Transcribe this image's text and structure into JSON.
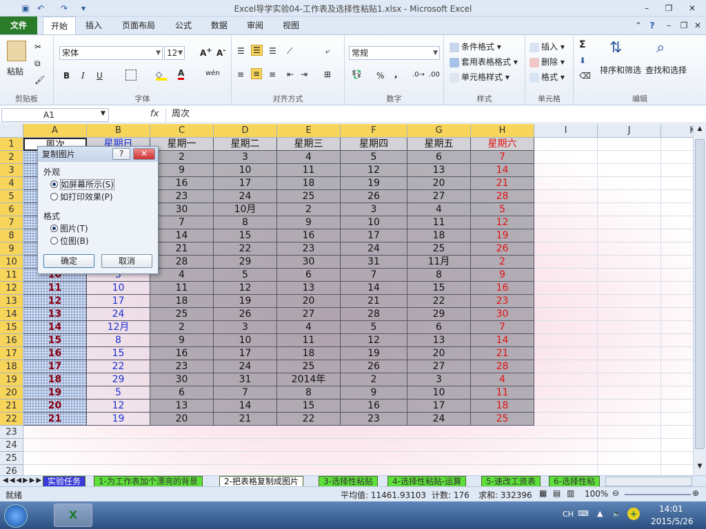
{
  "window": {
    "title": "Excel导学实验04-工作表及选择性粘贴1.xlsx - Microsoft Excel"
  },
  "qat": {
    "save_icon": "save-icon",
    "undo_icon": "undo-icon",
    "redo_icon": "redo-icon"
  },
  "tabs": [
    "文件",
    "开始",
    "插入",
    "页面布局",
    "公式",
    "数据",
    "审阅",
    "视图"
  ],
  "ribbon": {
    "clipboard": {
      "label": "剪贴板",
      "paste": "粘贴"
    },
    "font": {
      "label": "字体",
      "name": "宋体",
      "size": "12",
      "bold": "B",
      "italic": "I",
      "underline": "U",
      "wen": "wén"
    },
    "align": {
      "label": "对齐方式"
    },
    "number": {
      "label": "数字",
      "format": "常规",
      "percent": "%",
      "comma": ","
    },
    "styles": {
      "label": "样式",
      "cond": "条件格式",
      "table": "套用表格格式",
      "cell": "单元格样式"
    },
    "cells": {
      "label": "单元格",
      "insert": "插入",
      "delete": "删除",
      "format": "格式"
    },
    "editing": {
      "label": "编辑",
      "sort": "排序和筛选",
      "find": "查找和选择",
      "sigma": "Σ"
    }
  },
  "formula": {
    "namebox": "A1",
    "fx": "fx",
    "value": "周次"
  },
  "columns": [
    "A",
    "B",
    "C",
    "D",
    "E",
    "F",
    "G",
    "H",
    "I",
    "J",
    "K"
  ],
  "rows": [
    "1",
    "2",
    "3",
    "4",
    "5",
    "6",
    "7",
    "8",
    "9",
    "10",
    "11",
    "12",
    "13",
    "14",
    "15",
    "16",
    "17",
    "18",
    "19",
    "20",
    "21",
    "22",
    "23",
    "24",
    "25",
    "26"
  ],
  "table": {
    "header": [
      "周次",
      "星期日",
      "星期一",
      "星期二",
      "星期三",
      "星期四",
      "星期五",
      "星期六"
    ],
    "body": [
      [
        "",
        "",
        "2",
        "3",
        "4",
        "5",
        "6",
        "7"
      ],
      [
        "",
        "",
        "9",
        "10",
        "11",
        "12",
        "13",
        "14"
      ],
      [
        "",
        "",
        "16",
        "17",
        "18",
        "19",
        "20",
        "21"
      ],
      [
        "",
        "",
        "23",
        "24",
        "25",
        "26",
        "27",
        "28"
      ],
      [
        "",
        "",
        "30",
        "10月",
        "2",
        "3",
        "4",
        "5"
      ],
      [
        "",
        "",
        "7",
        "8",
        "9",
        "10",
        "11",
        "12"
      ],
      [
        "",
        "",
        "14",
        "15",
        "16",
        "17",
        "18",
        "19"
      ],
      [
        "",
        "",
        "21",
        "22",
        "23",
        "24",
        "25",
        "26"
      ],
      [
        "",
        "",
        "28",
        "29",
        "30",
        "31",
        "11月",
        "2"
      ],
      [
        "10",
        "3",
        "4",
        "5",
        "6",
        "7",
        "8",
        "9"
      ],
      [
        "11",
        "10",
        "11",
        "12",
        "13",
        "14",
        "15",
        "16"
      ],
      [
        "12",
        "17",
        "18",
        "19",
        "20",
        "21",
        "22",
        "23"
      ],
      [
        "13",
        "24",
        "25",
        "26",
        "27",
        "28",
        "29",
        "30"
      ],
      [
        "14",
        "12月",
        "2",
        "3",
        "4",
        "5",
        "6",
        "7"
      ],
      [
        "15",
        "8",
        "9",
        "10",
        "11",
        "12",
        "13",
        "14"
      ],
      [
        "16",
        "15",
        "16",
        "17",
        "18",
        "19",
        "20",
        "21"
      ],
      [
        "17",
        "22",
        "23",
        "24",
        "25",
        "26",
        "27",
        "28"
      ],
      [
        "18",
        "29",
        "30",
        "31",
        "2014年",
        "2",
        "3",
        "4"
      ],
      [
        "19",
        "5",
        "6",
        "7",
        "8",
        "9",
        "10",
        "11"
      ],
      [
        "20",
        "12",
        "13",
        "14",
        "15",
        "16",
        "17",
        "18"
      ],
      [
        "21",
        "19",
        "20",
        "21",
        "22",
        "23",
        "24",
        "25"
      ]
    ]
  },
  "dialog": {
    "title": "复制图片",
    "help": "?",
    "close": "✕",
    "appearance": "外观",
    "opt_screen": "如屏幕所示(S)",
    "opt_print": "如打印效果(P)",
    "format": "格式",
    "opt_picture": "图片(T)",
    "opt_bitmap": "位图(B)",
    "ok": "确定",
    "cancel": "取消"
  },
  "sheets": [
    "实验任务",
    "1-为工作表加个漂亮的背景",
    "2-把表格复制成图片",
    "3-选择性粘贴",
    "4-选择性粘贴-运算",
    "5-速改工资表",
    "6-选择性粘"
  ],
  "status": {
    "ready": "就绪",
    "avg": "平均值: 11461.93103",
    "count": "计数: 176",
    "sum": "求和: 332396",
    "zoom": "100%"
  },
  "taskbar": {
    "lang": "CH",
    "time": "14:01",
    "date": "2015/5/26"
  }
}
